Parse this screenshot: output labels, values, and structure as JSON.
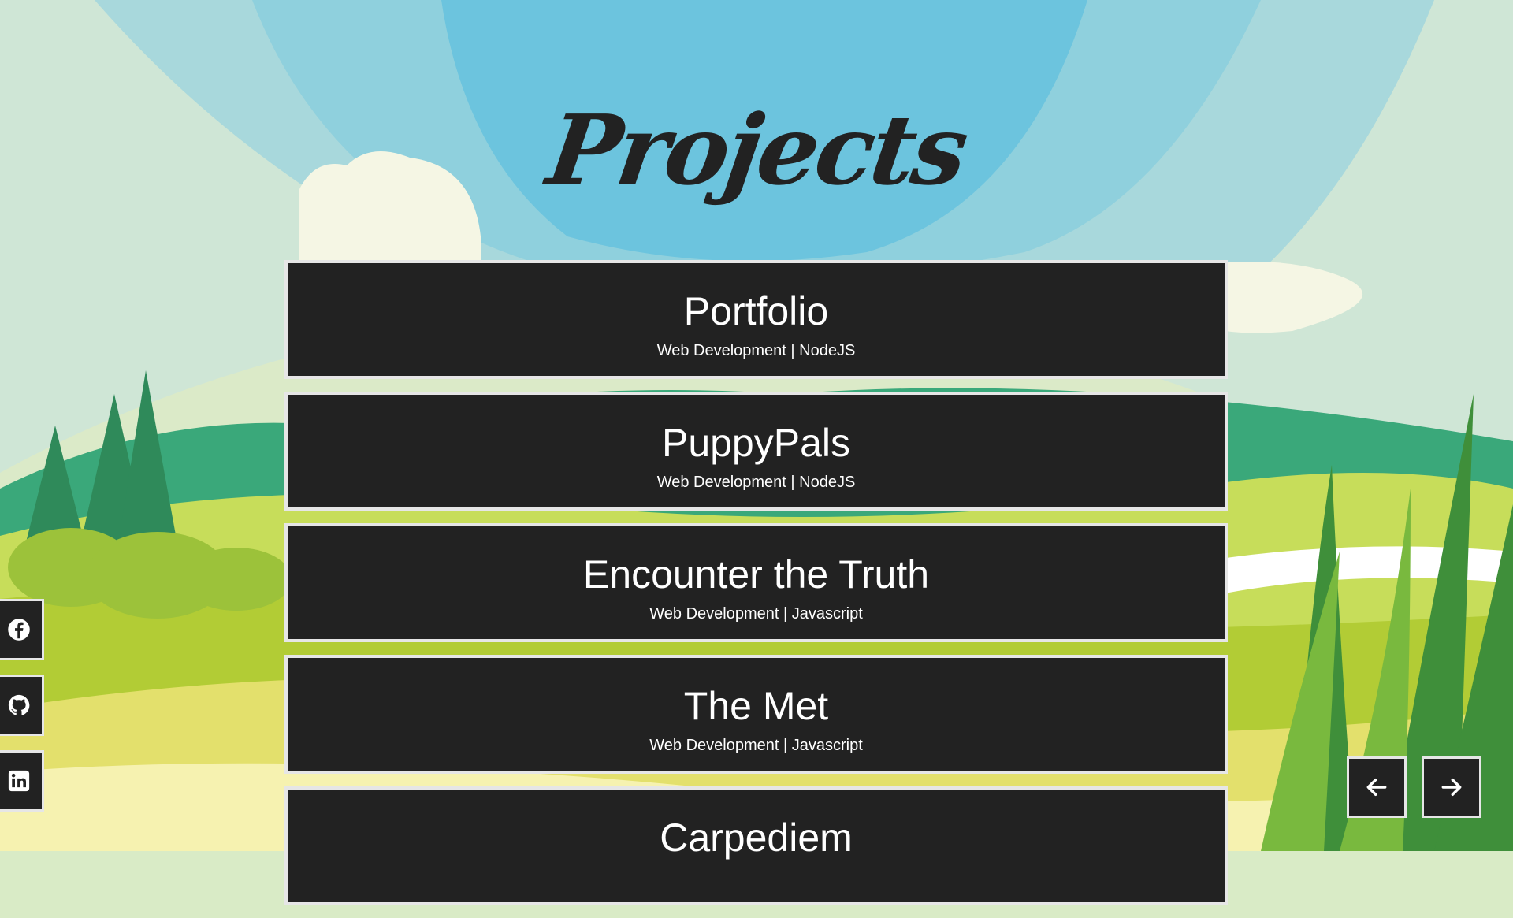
{
  "header": {
    "title": "Projects"
  },
  "projects": [
    {
      "name": "Portfolio",
      "tags": "Web Development | NodeJS"
    },
    {
      "name": "PuppyPals",
      "tags": "Web Development | NodeJS"
    },
    {
      "name": "Encounter the Truth",
      "tags": "Web Development | Javascript"
    },
    {
      "name": "The Met",
      "tags": "Web Development | Javascript"
    },
    {
      "name": "Carpediem",
      "tags": ""
    }
  ],
  "social": [
    {
      "icon": "facebook-icon"
    },
    {
      "icon": "github-icon"
    },
    {
      "icon": "linkedin-icon"
    }
  ],
  "nav": {
    "prev_icon": "arrow-left-icon",
    "next_icon": "arrow-right-icon"
  },
  "colors": {
    "card_bg": "#222222",
    "card_border": "#e6e6e6",
    "sky": "#6cc4de",
    "grass": "#b2cc35"
  }
}
